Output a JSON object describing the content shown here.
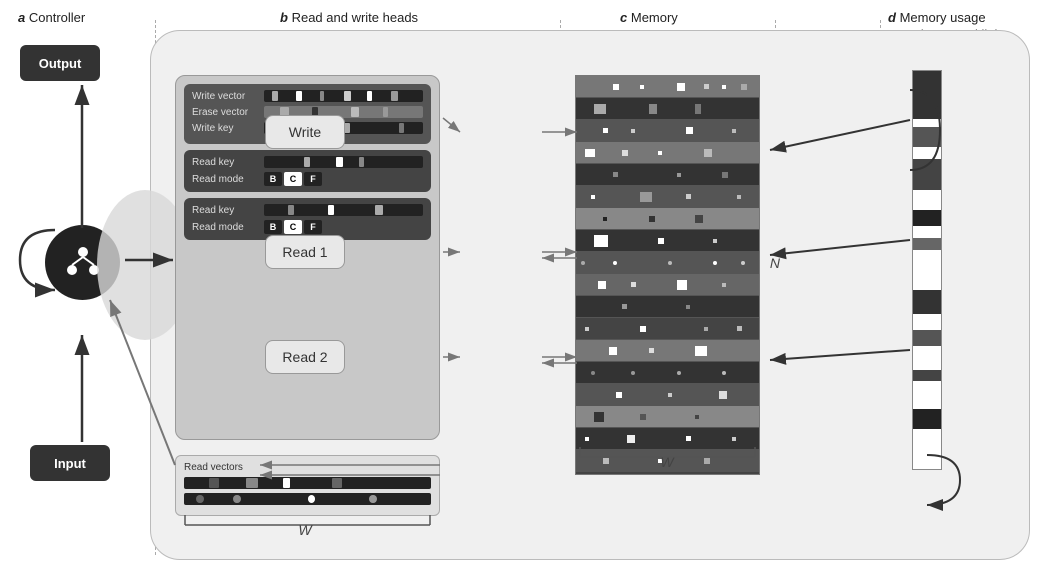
{
  "labels": {
    "a": "a",
    "a_title": "Controller",
    "b": "b",
    "b_title": "Read and write heads",
    "c": "c",
    "c_title": "Memory",
    "d": "d",
    "d_title": "Memory usage",
    "d_subtitle": "and temporal links"
  },
  "controller": {
    "output_label": "Output",
    "input_label": "Input"
  },
  "write_head": {
    "write_vector_label": "Write vector",
    "erase_vector_label": "Erase vector",
    "write_key_label": "Write key"
  },
  "read_head1": {
    "read_key_label": "Read key",
    "read_mode_label": "Read mode",
    "modes": [
      "B",
      "C",
      "F"
    ]
  },
  "read_head2": {
    "read_key_label": "Read key",
    "read_mode_label": "Read mode",
    "modes": [
      "B",
      "C",
      "F"
    ]
  },
  "read_vectors": {
    "label": "Read vectors"
  },
  "buttons": {
    "write": "Write",
    "read1": "Read 1",
    "read2": "Read 2"
  },
  "axis_labels": {
    "W": "W",
    "N": "N"
  }
}
